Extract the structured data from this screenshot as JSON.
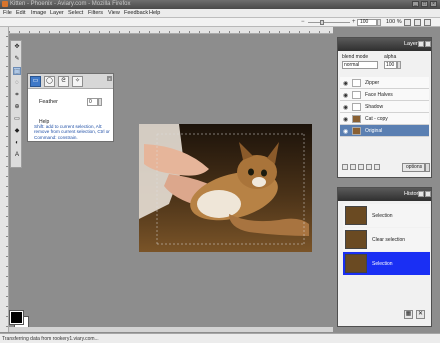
{
  "window": {
    "title": "Kitten - Phoenix - Aviary.com - Mozilla Firefox",
    "minimize_label": "_",
    "maximize_label": "□",
    "close_label": "×"
  },
  "menu": [
    "File",
    "Edit",
    "Image",
    "Layer",
    "Select",
    "Filters",
    "View",
    "Feedback",
    "Help"
  ],
  "zoom": {
    "value": "100",
    "percent_label": "100 %",
    "minus": "−",
    "plus": "+"
  },
  "tool_popup": {
    "feather_label": "Feather",
    "feather_value": "0",
    "help_label": "Help",
    "help_text": "Shift: add to current selection, Alt: remove from current selection, Ctrl or Command: constrain.",
    "close_label": "x"
  },
  "layers": {
    "title": "Layers",
    "blend_mode_label": "blend mode",
    "alpha_label": "alpha",
    "blend_mode_value": "normal",
    "alpha_value": "100",
    "items": [
      {
        "name": "Zipper",
        "selected": false
      },
      {
        "name": "Face Halves",
        "selected": false
      },
      {
        "name": "Shadow",
        "selected": false
      },
      {
        "name": "Cat - copy",
        "selected": false
      },
      {
        "name": "Original",
        "selected": true
      }
    ],
    "options_label": "options"
  },
  "history": {
    "title": "History",
    "items": [
      {
        "label": "Selection",
        "current": false
      },
      {
        "label": "Clear selection",
        "current": false
      },
      {
        "label": "Selection",
        "current": true
      }
    ]
  },
  "status": {
    "text": "Transferring data from rookery1.viary.com..."
  },
  "colors": {
    "foreground": "#000000",
    "background": "#ffffff",
    "selected_layer": "#5a7fb2",
    "current_history": "#1a2ff4",
    "accent": "#3f79c8"
  }
}
